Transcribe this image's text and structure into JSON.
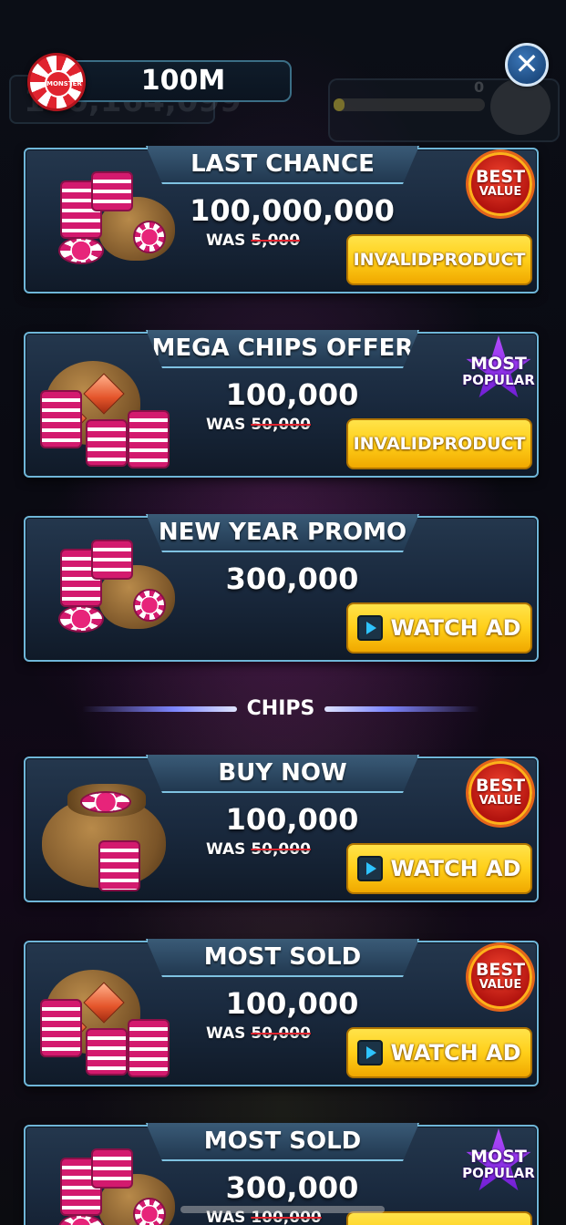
{
  "header": {
    "balance": "100M",
    "logo_text": "MONSTER",
    "close_label": "✕",
    "background_balance": "100,164,099",
    "background_level": "0"
  },
  "offers": [
    {
      "title": "LAST CHANCE",
      "amount": "100,000,000",
      "was_label": "WAS",
      "was_value": "5,000",
      "button": "INVALIDPRODUCT",
      "button_type": "purchase",
      "badge": {
        "line1": "BEST",
        "line2": "VALUE",
        "type": "best"
      },
      "art": "chips-bag"
    },
    {
      "title": "MEGA CHIPS OFFER",
      "amount": "100,000",
      "was_label": "WAS",
      "was_value": "50,000",
      "button": "INVALIDPRODUCT",
      "button_type": "purchase",
      "badge": {
        "line1": "MOST",
        "line2": "POPULAR",
        "type": "popular"
      },
      "art": "treasure-bag"
    },
    {
      "title": "NEW YEAR PROMO",
      "amount": "300,000",
      "was_label": "",
      "was_value": "",
      "button": "WATCH AD",
      "button_type": "ad",
      "badge": null,
      "art": "chips-bag"
    }
  ],
  "section_label": "CHIPS",
  "chips_offers": [
    {
      "title": "BUY NOW",
      "amount": "100,000",
      "was_label": "WAS",
      "was_value": "50,000",
      "button": "WATCH AD",
      "button_type": "ad",
      "badge": {
        "line1": "BEST",
        "line2": "VALUE",
        "type": "best"
      },
      "art": "big-bag"
    },
    {
      "title": "MOST SOLD",
      "amount": "100,000",
      "was_label": "WAS",
      "was_value": "50,000",
      "button": "WATCH AD",
      "button_type": "ad",
      "badge": {
        "line1": "BEST",
        "line2": "VALUE",
        "type": "best"
      },
      "art": "treasure-bag"
    },
    {
      "title": "MOST SOLD",
      "amount": "300,000",
      "was_label": "WAS",
      "was_value": "100,000",
      "button": "",
      "button_type": "purchase",
      "badge": {
        "line1": "MOST",
        "line2": "POPULAR",
        "type": "popular"
      },
      "art": "chips-bag"
    }
  ],
  "colors": {
    "card_border": "#6fb6d8",
    "button_yellow": "#ffcf19",
    "badge_best": "#d3241a",
    "badge_popular": "#8a2de0",
    "chip_pink": "#d31a6e"
  }
}
